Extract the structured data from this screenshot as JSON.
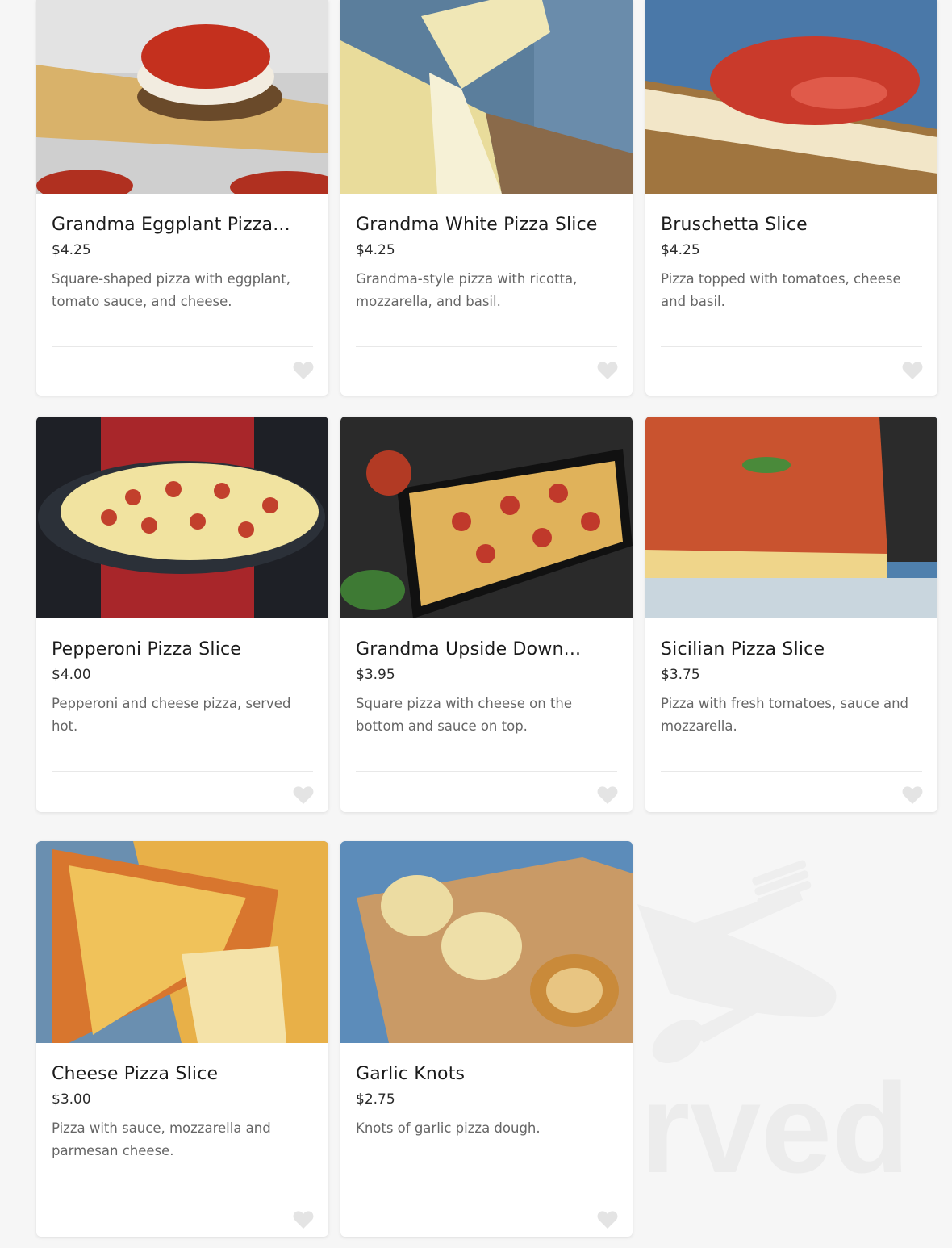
{
  "menu": {
    "items": [
      {
        "name": "Grandma Eggplant Pizza...",
        "price": "$4.25",
        "description": "Square-shaped pizza with eggplant, tomato sauce, and cheese.",
        "image": "eggplant-pizza-photo"
      },
      {
        "name": "Grandma White Pizza Slice",
        "price": "$4.25",
        "description": "Grandma-style pizza with ricotta, mozzarella, and basil.",
        "image": "white-pizza-photo"
      },
      {
        "name": "Bruschetta Slice",
        "price": "$4.25",
        "description": "Pizza topped with tomatoes, cheese and basil.",
        "image": "bruschetta-photo"
      },
      {
        "name": "Pepperoni Pizza Slice",
        "price": "$4.00",
        "description": "Pepperoni and cheese pizza, served hot.",
        "image": "pepperoni-pizza-photo"
      },
      {
        "name": "Grandma Upside Down...",
        "price": "$3.95",
        "description": "Square pizza with cheese on the bottom and sauce on top.",
        "image": "upside-down-pizza-photo"
      },
      {
        "name": "Sicilian Pizza Slice",
        "price": "$3.75",
        "description": "Pizza with fresh tomatoes, sauce and mozzarella.",
        "image": "sicilian-pizza-photo"
      },
      {
        "name": "Cheese Pizza Slice",
        "price": "$3.00",
        "description": "Pizza with sauce, mozzarella and parmesan cheese.",
        "image": "cheese-pizza-photo"
      },
      {
        "name": "Garlic Knots",
        "price": "$2.75",
        "description": "Knots of garlic pizza dough.",
        "image": "garlic-knots-photo"
      }
    ]
  },
  "watermark": {
    "text": "sirved",
    "icon": "fork-knife-icon"
  },
  "colors": {
    "page_bg": "#f6f6f6",
    "card_bg": "#ffffff",
    "heart": "#e4e4e4"
  }
}
